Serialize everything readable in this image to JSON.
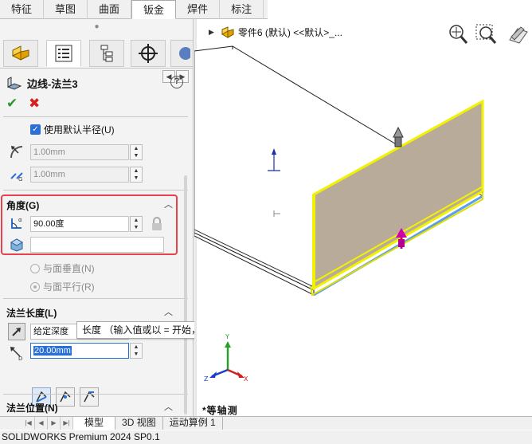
{
  "command_tabs": [
    "特征",
    "草图",
    "曲面",
    "钣金",
    "焊件",
    "标注"
  ],
  "active_command_tab": "钣金",
  "feature": {
    "title": "边线-法兰3",
    "help": "?"
  },
  "radius": {
    "use_default_label": "使用默认半径(U)",
    "use_default_checked": true,
    "bend_radius": "1.00mm",
    "gap": "1.00mm"
  },
  "angle": {
    "header": "角度(G)",
    "value": "90.00度",
    "reference": ""
  },
  "radios": {
    "perpendicular": "与面垂直(N)",
    "parallel": "与面平行(R)"
  },
  "flange_length": {
    "header": "法兰长度(L)",
    "end_condition": "给定深度",
    "tooltip": "长度 （输入值或以 = 开始，以创建方程式）",
    "value": "20.00mm"
  },
  "flange_position": {
    "header": "法兰位置(N)"
  },
  "viewport": {
    "breadcrumb": "零件6 (默认) <<默认>_...",
    "view_name": "*等轴测",
    "triad_x": "X",
    "triad_y": "Y",
    "triad_z": "Z"
  },
  "bottom_tabs": [
    "模型",
    "3D 视图",
    "运动算例 1"
  ],
  "active_bottom_tab": "模型",
  "status": "SOLIDWORKS Premium 2024 SP0.1",
  "colors": {
    "accent": "#2a6fd6",
    "highlight_border": "#e8424f",
    "flange_fill": "#b9ab9a",
    "flange_edge": "#f2f200",
    "edge_blue": "#5a9cf5"
  }
}
